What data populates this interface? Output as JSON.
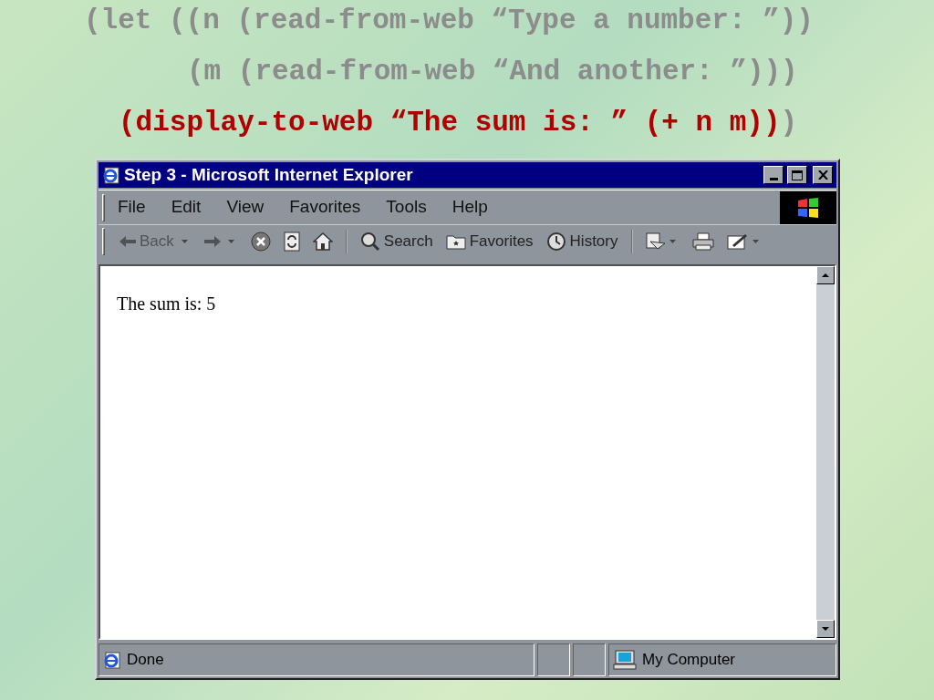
{
  "code_lines": [
    {
      "segments": [
        {
          "text": "(let ((n (read-from-web “Type a number: ”))",
          "highlight": false
        }
      ]
    },
    {
      "segments": [
        {
          "text": "(m (read-from-web “And another: ”)))",
          "highlight": false
        }
      ]
    },
    {
      "segments": [
        {
          "text": "(display-to-web “The sum is: ” (+ n m))",
          "highlight": true
        },
        {
          "text": ")",
          "highlight": false
        }
      ]
    }
  ],
  "window": {
    "title": "Step 3 - Microsoft Internet Explorer",
    "menu": [
      "File",
      "Edit",
      "View",
      "Favorites",
      "Tools",
      "Help"
    ],
    "toolbar": [
      {
        "kind": "back",
        "label": "Back",
        "disabled": true
      },
      {
        "kind": "forward",
        "disabled": true
      },
      {
        "kind": "stop"
      },
      {
        "kind": "refresh"
      },
      {
        "kind": "home"
      },
      {
        "kind": "sep"
      },
      {
        "kind": "search",
        "label": "Search"
      },
      {
        "kind": "favorites",
        "label": "Favorites"
      },
      {
        "kind": "history",
        "label": "History"
      },
      {
        "kind": "sep"
      },
      {
        "kind": "edit"
      },
      {
        "kind": "print"
      },
      {
        "kind": "compose"
      }
    ],
    "content": "The sum is: 5",
    "status": {
      "text": "Done",
      "zone": "My Computer"
    }
  }
}
